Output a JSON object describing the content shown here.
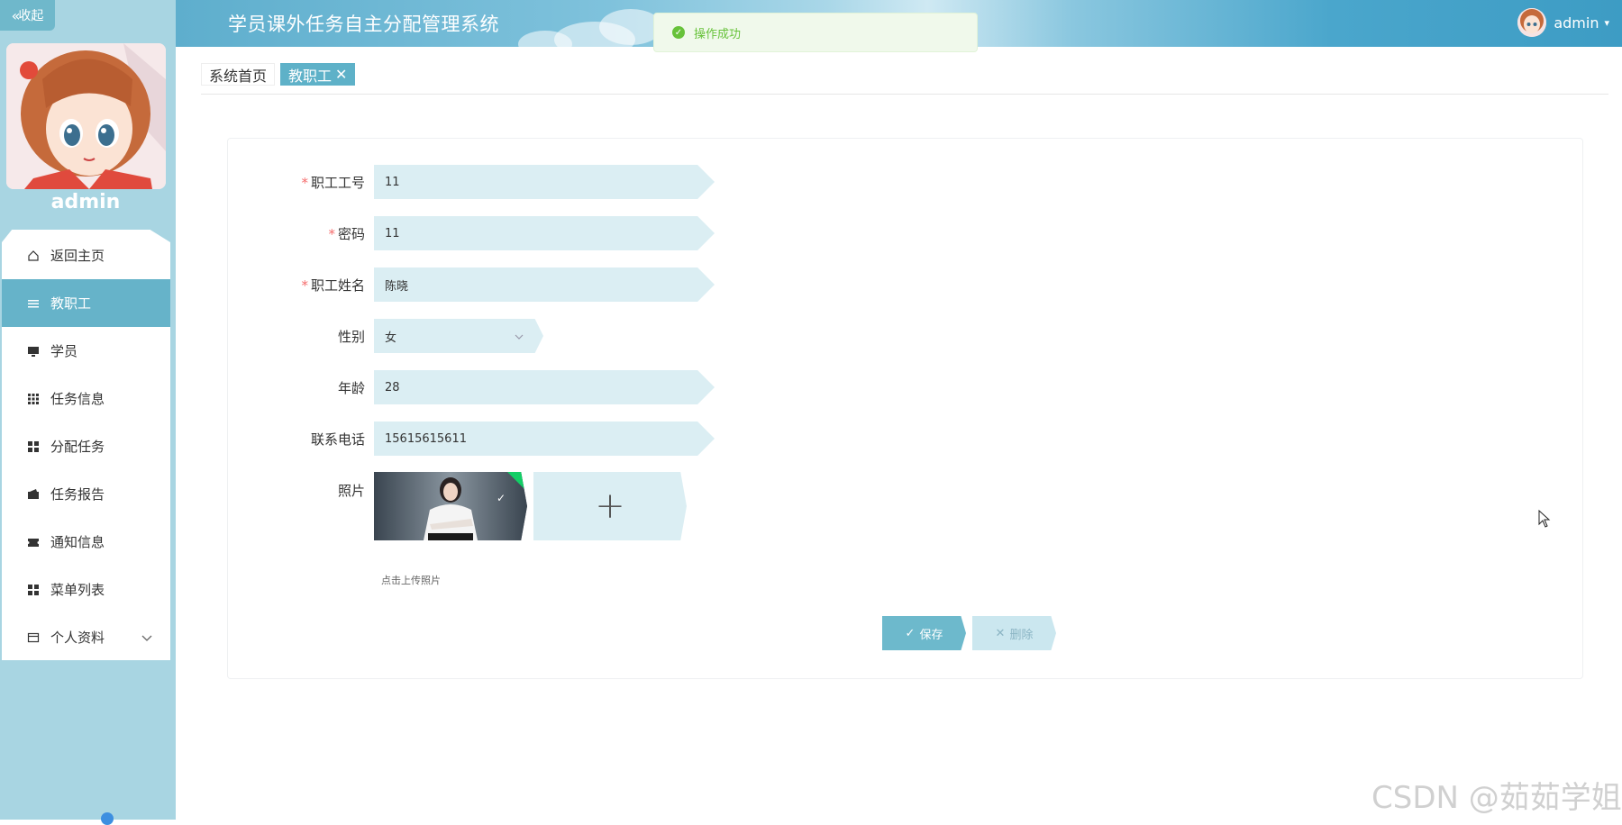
{
  "sidebar": {
    "collapse_label": "收起",
    "username": "admin",
    "items": [
      {
        "label": "返回主页",
        "icon": "home-icon"
      },
      {
        "label": "教职工",
        "icon": "menu-icon"
      },
      {
        "label": "学员",
        "icon": "monitor-icon"
      },
      {
        "label": "任务信息",
        "icon": "grid-icon"
      },
      {
        "label": "分配任务",
        "icon": "apps-icon"
      },
      {
        "label": "任务报告",
        "icon": "wallet-icon"
      },
      {
        "label": "通知信息",
        "icon": "ticket-icon"
      },
      {
        "label": "菜单列表",
        "icon": "apps-icon"
      },
      {
        "label": "个人资料",
        "icon": "profile-icon"
      }
    ],
    "active_index": 1
  },
  "header": {
    "title": "学员课外任务自主分配管理系统",
    "user": "admin"
  },
  "toast": {
    "message": "操作成功",
    "color": "#67c23a"
  },
  "tabs": [
    {
      "label": "系统首页"
    },
    {
      "label": "教职工",
      "closable_glyph": "✕"
    }
  ],
  "form": {
    "fields": {
      "staff_id": {
        "label": "职工工号",
        "value": "11",
        "required": true
      },
      "password": {
        "label": "密码",
        "value": "11",
        "required": true
      },
      "staff_name": {
        "label": "职工姓名",
        "value": "陈晓",
        "required": true
      },
      "gender": {
        "label": "性别",
        "value": "女",
        "required": false
      },
      "age": {
        "label": "年龄",
        "value": "28",
        "required": false
      },
      "phone": {
        "label": "联系电话",
        "value": "15615615611",
        "required": false
      },
      "photo": {
        "label": "照片",
        "hint": "点击上传照片",
        "upload_glyph": "+"
      }
    },
    "buttons": {
      "save": "保存",
      "delete": "删除"
    }
  },
  "watermark": "CSDN @茹茹学姐",
  "colors": {
    "sidebar_bg": "#a8d5e2",
    "accent": "#66b3c9",
    "field_bg": "#dbeef3"
  }
}
